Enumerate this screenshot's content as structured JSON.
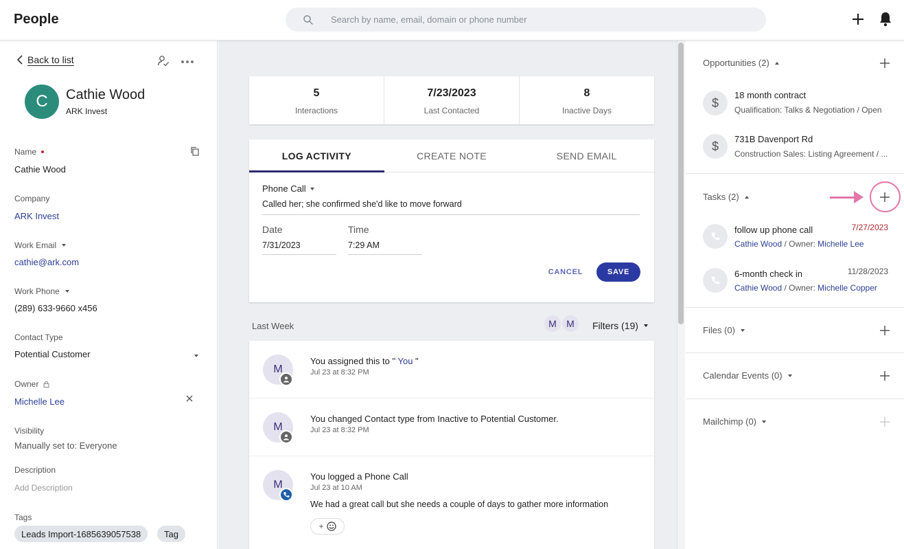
{
  "app": {
    "title": "People"
  },
  "search": {
    "placeholder": "Search by name, email, domain or phone number"
  },
  "left": {
    "back_label": "Back to list",
    "avatar_initial": "C",
    "name": "Cathie Wood",
    "company": "ARK Invest",
    "fields": {
      "name_label": "Name",
      "name_value": "Cathie Wood",
      "company_label": "Company",
      "company_value": "ARK Invest",
      "work_email_label": "Work Email",
      "work_email_value": "cathie@ark.com",
      "work_phone_label": "Work Phone",
      "work_phone_value": "(289) 633-9660 x456",
      "contact_type_label": "Contact Type",
      "contact_type_value": "Potential Customer",
      "owner_label": "Owner",
      "owner_value": "Michelle Lee",
      "visibility_label": "Visibility",
      "visibility_value": "Manually set to: Everyone",
      "description_label": "Description",
      "description_placeholder": "Add Description",
      "tags_label": "Tags"
    },
    "tags": [
      "Leads Import-1685639057538",
      "Tag"
    ]
  },
  "stats": [
    {
      "value": "5",
      "label": "Interactions"
    },
    {
      "value": "7/23/2023",
      "label": "Last Contacted"
    },
    {
      "value": "8",
      "label": "Inactive Days"
    }
  ],
  "activity": {
    "tabs": [
      "LOG ACTIVITY",
      "CREATE NOTE",
      "SEND EMAIL"
    ],
    "type": "Phone Call",
    "note": "Called her; she confirmed she'd like to move forward",
    "date_label": "Date",
    "date_value": "7/31/2023",
    "time_label": "Time",
    "time_value": "7:29 AM",
    "cancel": "CANCEL",
    "save": "SAVE"
  },
  "feed": {
    "section": "Last Week",
    "avatars": [
      "M",
      "M"
    ],
    "filters": "Filters (19)",
    "items": [
      {
        "avatar": "M",
        "title_prefix": "You assigned this to \"",
        "title_link": " You ",
        "title_suffix": "\"",
        "time": "Jul 23 at 8:32 PM"
      },
      {
        "avatar": "M",
        "title": "You changed Contact type from Inactive to Potential Customer.",
        "time": "Jul 23 at 8:32 PM"
      },
      {
        "avatar": "M",
        "title": "You logged a Phone Call",
        "time": "Jul 23 at 10 AM",
        "body": "We had a great call but she needs a couple of days to gather more information",
        "react": "+"
      }
    ]
  },
  "right": {
    "opportunities": {
      "label": "Opportunities (2)",
      "items": [
        {
          "title": "18 month contract",
          "sub": "Qualification: Talks & Negotiation / Open"
        },
        {
          "title": "731B Davenport Rd",
          "sub": "Construction Sales: Listing Agreement / ..."
        }
      ]
    },
    "tasks": {
      "label": "Tasks (2)",
      "items": [
        {
          "title": "follow up phone call",
          "date": "7/27/2023",
          "contact": "Cathie Wood",
          "owner_prefix": " / Owner: ",
          "owner": "Michelle Lee"
        },
        {
          "title": "6-month check in",
          "date": "11/28/2023",
          "contact": "Cathie Wood",
          "owner_prefix": " / Owner: ",
          "owner": "Michelle Copper"
        }
      ]
    },
    "files": {
      "label": "Files (0)"
    },
    "calendar": {
      "label": "Calendar Events (0)"
    },
    "mailchimp": {
      "label": "Mailchimp (0)"
    }
  },
  "colors": {
    "accent": "#2b3aa3",
    "link": "#2d3f94",
    "avatar": "#2b8c7c",
    "overdue": "#b0282e",
    "annotation": "#e377a8"
  }
}
